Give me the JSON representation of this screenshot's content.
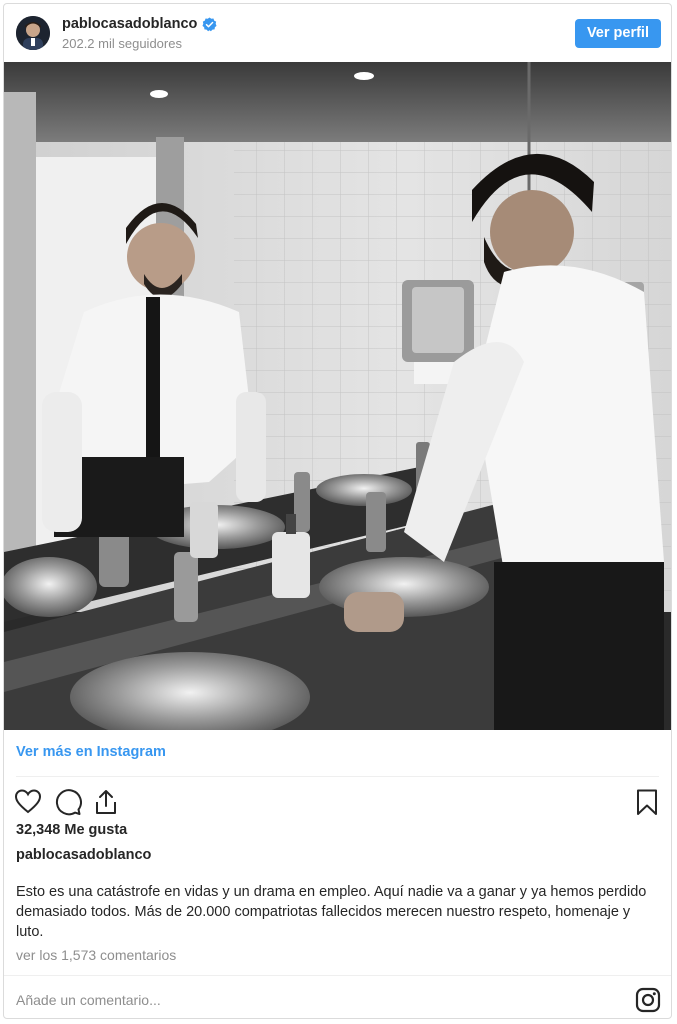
{
  "header": {
    "username": "pablocasadoblanco",
    "followers": "202.2 mil seguidores",
    "profile_button": "Ver perfil",
    "verified_icon": "verified-badge-icon",
    "accent_color": "#3897f0"
  },
  "photo": {
    "description_icon": "bathroom-mirror-photo"
  },
  "more_link": "Ver más en Instagram",
  "actions": {
    "like_icon": "heart-icon",
    "comment_icon": "comment-icon",
    "share_icon": "share-icon",
    "save_icon": "bookmark-icon"
  },
  "likes": "32,348 Me gusta",
  "caption": {
    "username": "pablocasadoblanco",
    "text": "Esto es una catástrofe en vidas y un drama en empleo. Aquí nadie va a ganar y ya hemos perdido demasiado todos. Más de 20.000 compatriotas fallecidos merecen nuestro respeto, homenaje y luto."
  },
  "comments_link": "ver los 1,573 comentarios",
  "comment_box": {
    "placeholder": "Añade un comentario...",
    "value": ""
  }
}
